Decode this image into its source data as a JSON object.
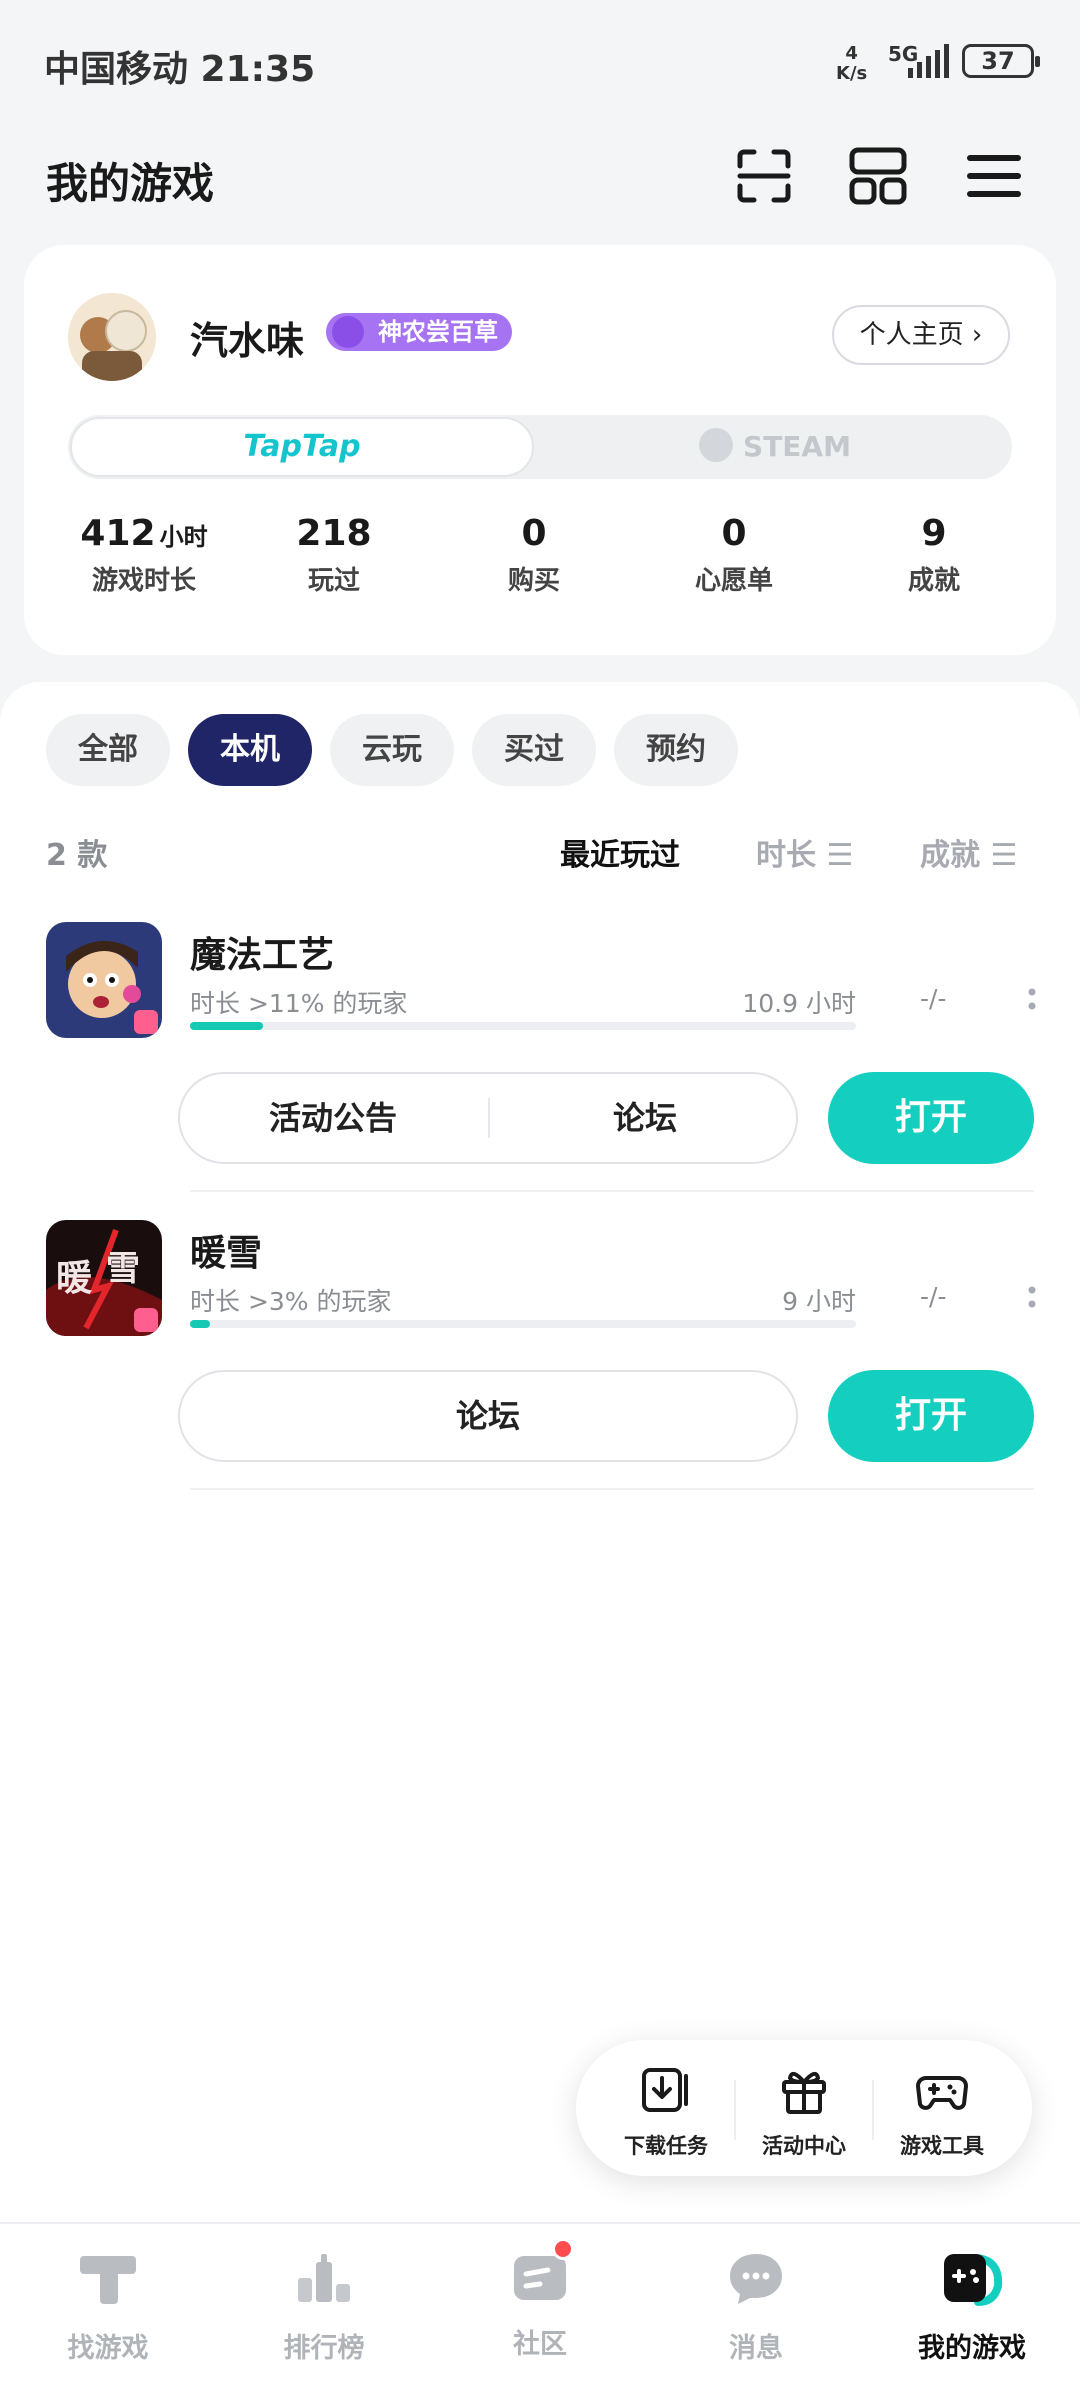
{
  "status_bar": {
    "carrier_time": "中国移动 21:35",
    "net_speed_value": "4",
    "net_speed_unit": "K/s",
    "network": "5G",
    "battery": "37"
  },
  "header": {
    "title": "我的游戏",
    "icons": [
      "scan-icon",
      "grid-icon",
      "menu-icon"
    ]
  },
  "profile": {
    "username": "汽水味",
    "badge": "神农尝百草",
    "home_button": "个人主页 ›",
    "platform_tabs": {
      "taptap": "TapTap",
      "steam": "STEAM"
    },
    "stats": [
      {
        "value": "412",
        "unit": "小时",
        "label": "游戏时长"
      },
      {
        "value": "218",
        "unit": "",
        "label": "玩过"
      },
      {
        "value": "0",
        "unit": "",
        "label": "购买"
      },
      {
        "value": "0",
        "unit": "",
        "label": "心愿单"
      },
      {
        "value": "9",
        "unit": "",
        "label": "成就"
      }
    ]
  },
  "filters": {
    "chips": [
      "全部",
      "本机",
      "云玩",
      "买过",
      "预约"
    ],
    "active": "本机"
  },
  "list": {
    "count": "2 款",
    "sort_options": [
      "最近玩过",
      "时长 ☰",
      "成就 ☰"
    ],
    "games": [
      {
        "name": "魔法工艺",
        "subtitle": "时长 >11% 的玩家",
        "hours": "10.9 小时",
        "achievements": "-/-",
        "progress": 0.11,
        "actions": [
          "活动公告",
          "论坛"
        ],
        "open_label": "打开"
      },
      {
        "name": "暖雪",
        "subtitle": "时长 >3% 的玩家",
        "hours": "9 小时",
        "achievements": "-/-",
        "progress": 0.03,
        "actions": [
          "论坛"
        ],
        "open_label": "打开"
      }
    ]
  },
  "float_tools": [
    "下载任务",
    "活动中心",
    "游戏工具"
  ],
  "bottom_nav": {
    "items": [
      "找游戏",
      "排行榜",
      "社区",
      "消息",
      "我的游戏"
    ],
    "active": "我的游戏"
  },
  "colors": {
    "accent": "#14cfc0",
    "active_chip": "#1f2567",
    "badge": "#a673f2",
    "notification": "#ff4d4f"
  }
}
